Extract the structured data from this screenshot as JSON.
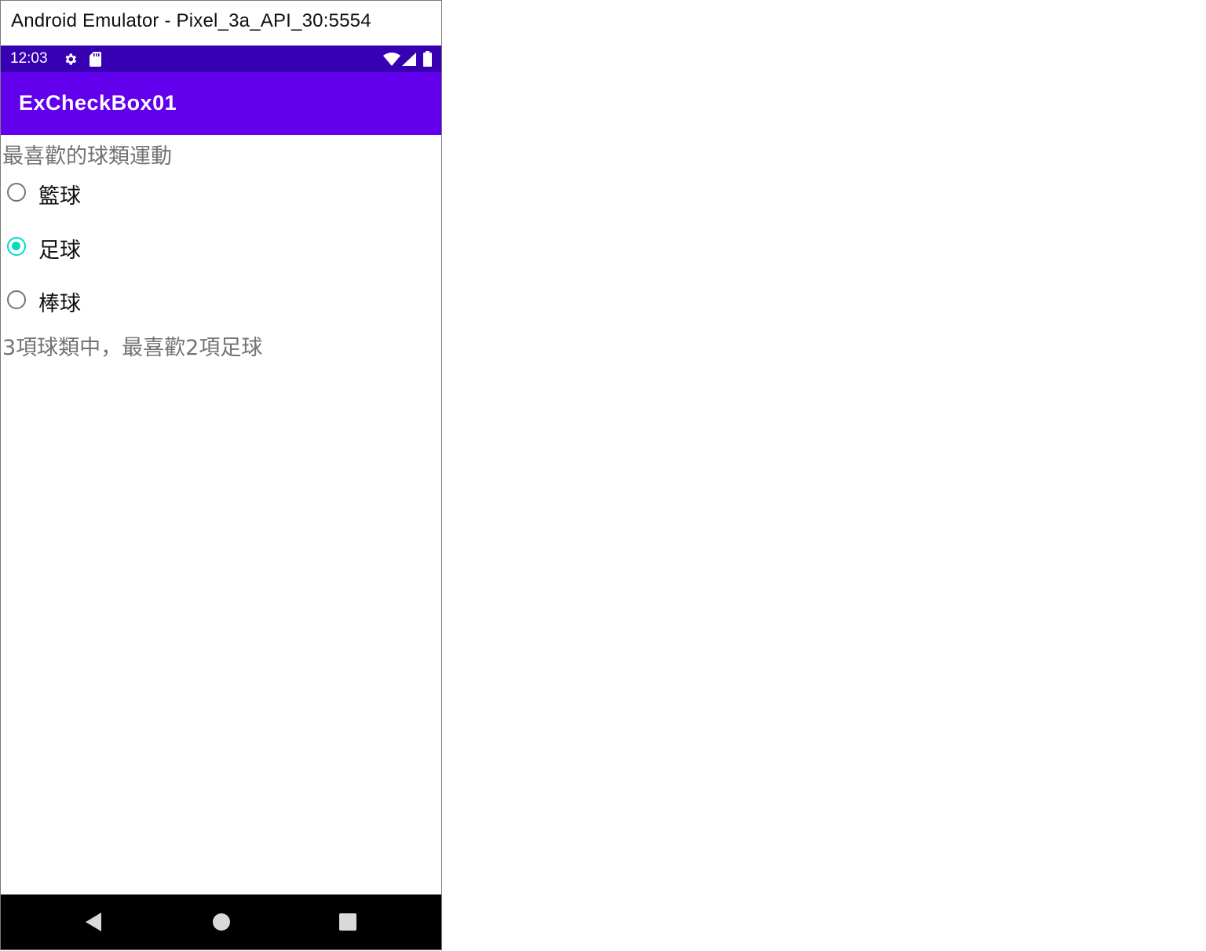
{
  "window": {
    "title": "Android Emulator - Pixel_3a_API_30:5554"
  },
  "statusbar": {
    "time": "12:03",
    "icons_left": [
      "gear-icon",
      "sd-card-icon"
    ],
    "icons_right": [
      "wifi-icon",
      "cell-signal-icon",
      "battery-icon"
    ]
  },
  "appbar": {
    "title": "ExCheckBox01",
    "color": "#6200ee",
    "status_color": "#3700b3"
  },
  "content": {
    "heading": "最喜歡的球類運動",
    "options": [
      {
        "label": "籃球",
        "checked": false
      },
      {
        "label": "足球",
        "checked": true
      },
      {
        "label": "棒球",
        "checked": false
      }
    ],
    "result": "3項球類中，最喜歡2項足球",
    "accent_color": "#03dac5"
  },
  "navbar": {
    "buttons": [
      "back-icon",
      "home-icon",
      "recents-icon"
    ]
  }
}
